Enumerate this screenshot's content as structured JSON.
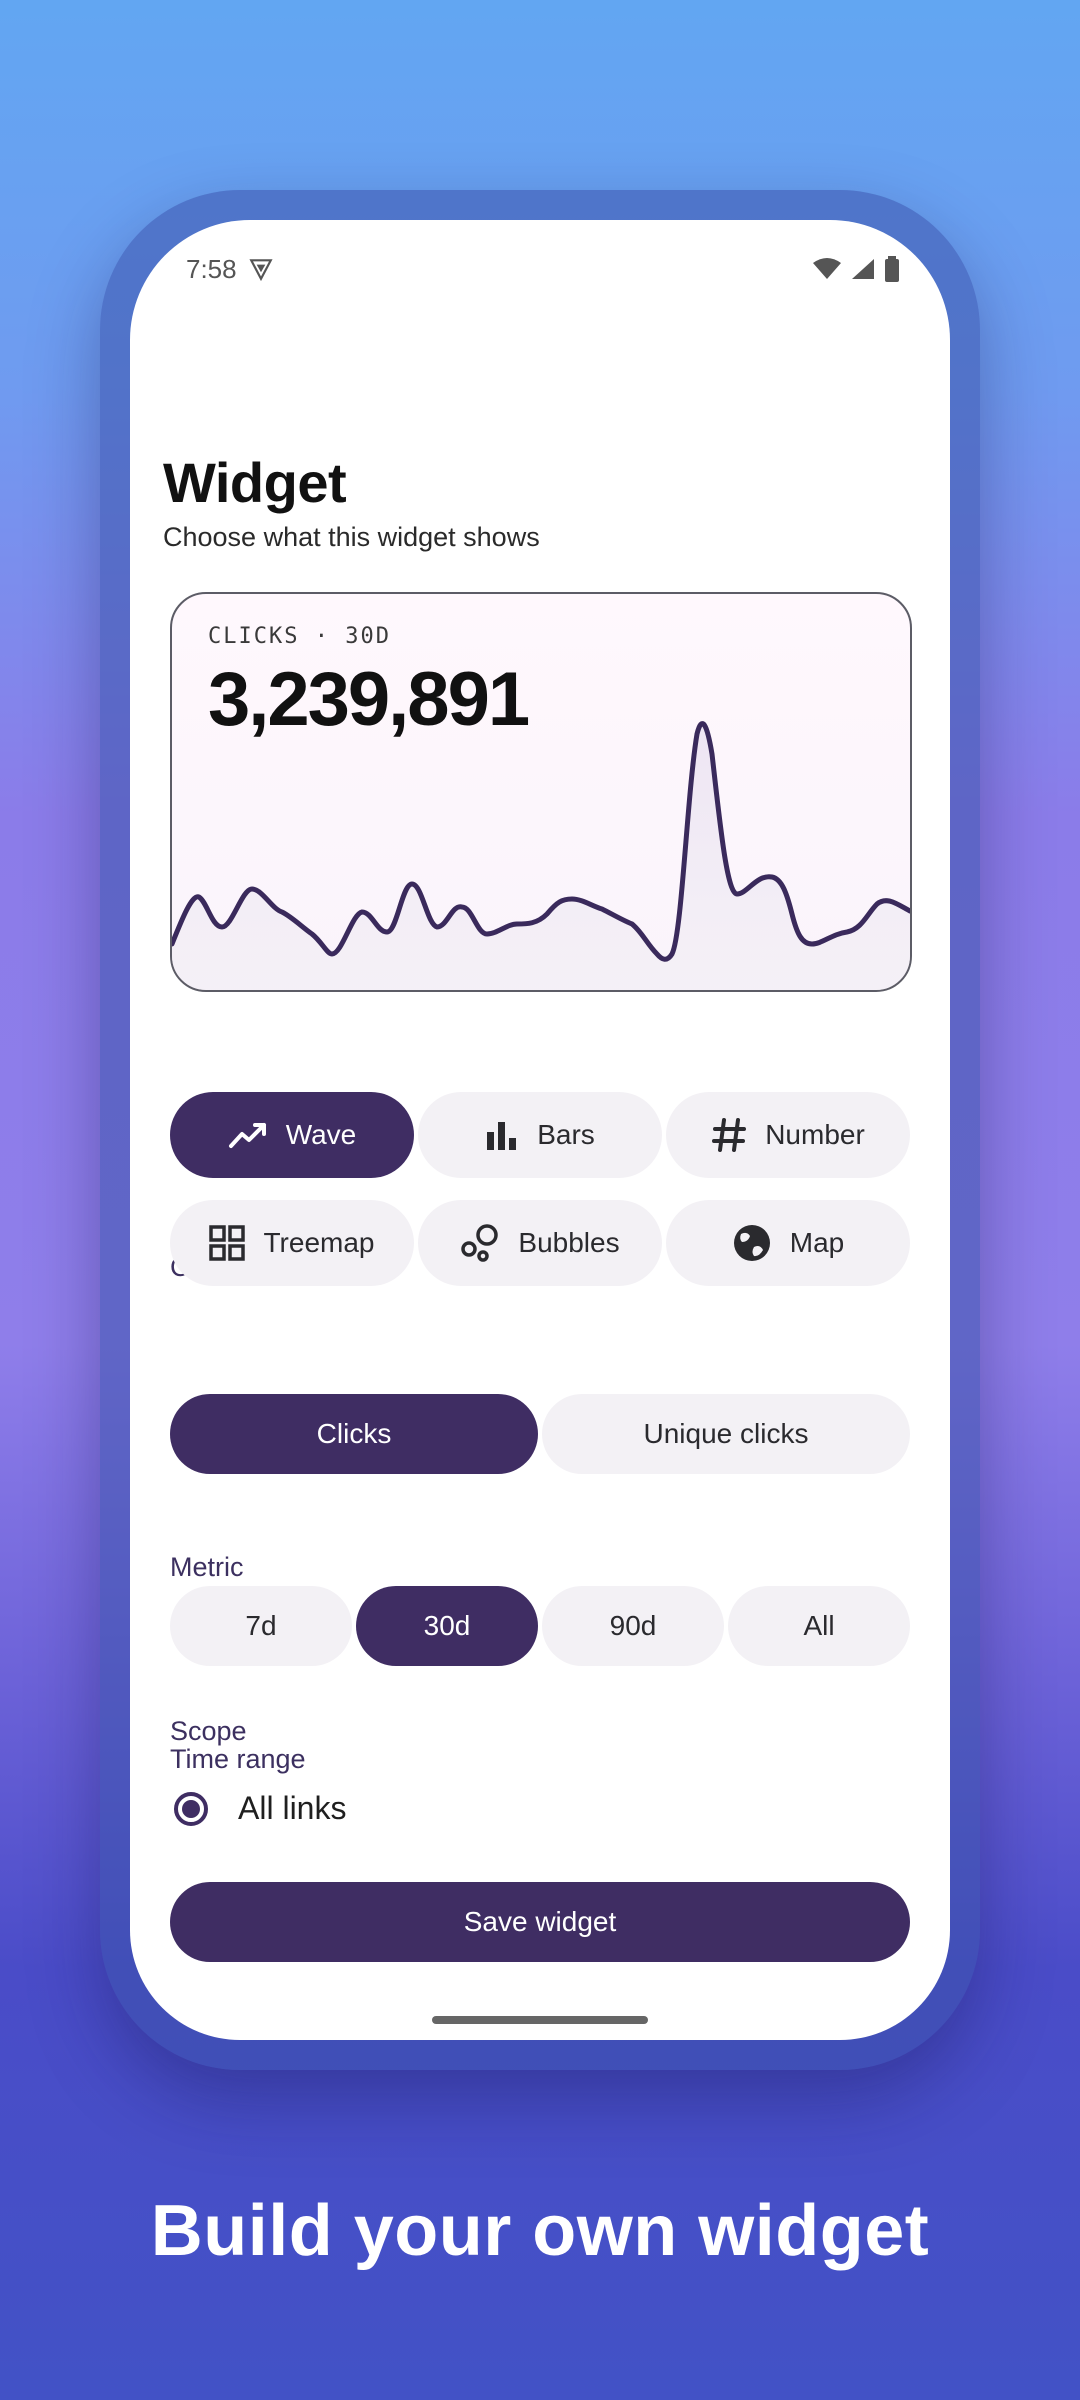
{
  "status": {
    "time": "7:58"
  },
  "header": {
    "title": "Widget",
    "subtitle": "Choose what this widget shows"
  },
  "preview": {
    "label": "CLICKS · 30D",
    "value": "3,239,891",
    "accent": "#3f2d63"
  },
  "chart_section": {
    "label": "Chart",
    "options": [
      {
        "label": "Wave",
        "icon": "trending-up-icon",
        "selected": true
      },
      {
        "label": "Bars",
        "icon": "bar-chart-icon",
        "selected": false
      },
      {
        "label": "Number",
        "icon": "hash-icon",
        "selected": false
      },
      {
        "label": "Treemap",
        "icon": "grid-icon",
        "selected": false
      },
      {
        "label": "Bubbles",
        "icon": "bubbles-icon",
        "selected": false
      },
      {
        "label": "Map",
        "icon": "globe-icon",
        "selected": false
      }
    ]
  },
  "metric_section": {
    "label": "Metric",
    "options": [
      {
        "label": "Clicks",
        "selected": true
      },
      {
        "label": "Unique clicks",
        "selected": false
      }
    ]
  },
  "time_section": {
    "label": "Time range",
    "options": [
      {
        "label": "7d",
        "selected": false
      },
      {
        "label": "30d",
        "selected": true
      },
      {
        "label": "90d",
        "selected": false
      },
      {
        "label": "All",
        "selected": false
      }
    ]
  },
  "scope_section": {
    "label": "Scope",
    "option": "All links",
    "selected": true
  },
  "save_label": "Save widget",
  "caption": "Build your own widget",
  "colors": {
    "primary": "#3f2d63",
    "chip_bg": "#f3f1f5"
  }
}
